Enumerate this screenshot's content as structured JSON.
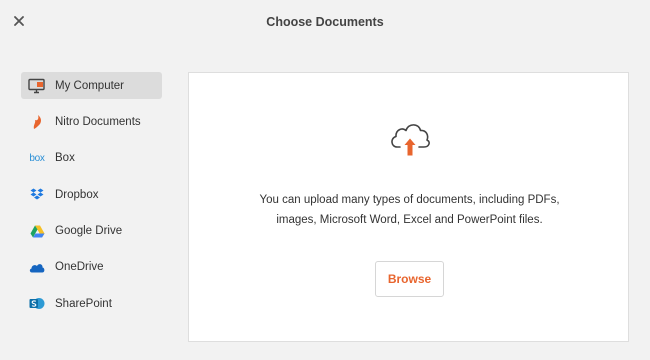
{
  "header": {
    "title": "Choose Documents",
    "close_icon": "close-icon"
  },
  "sidebar": {
    "items": [
      {
        "label": "My Computer",
        "icon": "computer-icon",
        "active": true
      },
      {
        "label": "Nitro Documents",
        "icon": "nitro-icon"
      },
      {
        "label": "Box",
        "icon": "box-logo-icon",
        "icon_text": "box"
      },
      {
        "label": "Dropbox",
        "icon": "dropbox-icon"
      },
      {
        "label": "Google Drive",
        "icon": "google-drive-icon"
      },
      {
        "label": "OneDrive",
        "icon": "onedrive-icon"
      },
      {
        "label": "SharePoint",
        "icon": "sharepoint-icon"
      }
    ]
  },
  "main": {
    "upload_icon": "cloud-upload-icon",
    "description": "You can upload many types of documents, including PDFs, images, Microsoft Word, Excel and PowerPoint files.",
    "browse_label": "Browse"
  },
  "colors": {
    "accent": "#e8652e",
    "background": "#f2f2f2",
    "panel": "#ffffff",
    "active_item": "#dcdcdc"
  }
}
